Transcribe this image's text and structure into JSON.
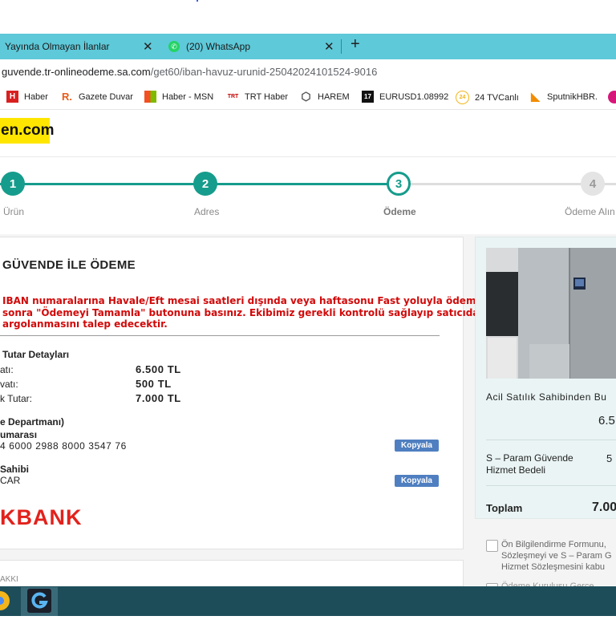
{
  "browser": {
    "tabs": [
      {
        "title": "Yayında Olmayan İlanlar",
        "close": "✕"
      },
      {
        "title": "(20) WhatsApp",
        "close": "✕"
      }
    ],
    "new_tab": "+",
    "url_host": "guvende.tr-onlineodeme.sa.com",
    "url_path": "/get60/iban-havuz-urunid-25042024101524-9016",
    "bookmarks": [
      {
        "label": "Haber",
        "icon": "H",
        "color": "#d92020"
      },
      {
        "label": "Gazete Duvar",
        "icon": "R.",
        "color": "#e85c1a"
      },
      {
        "label": "Haber - MSN",
        "icon": "▦",
        "color": "#f25022"
      },
      {
        "label": "TRT Haber",
        "icon": "TRT",
        "color": "#c00000"
      },
      {
        "label": "HAREM",
        "icon": "⬡",
        "color": "#555555"
      },
      {
        "label": "EURUSD1.08992",
        "icon": "17",
        "color": "#111111"
      },
      {
        "label": "24 TVCanlı",
        "icon": "24",
        "color": "#f2b51a"
      },
      {
        "label": "SputnikHBR.",
        "icon": "◣",
        "color": "#f28c00"
      }
    ]
  },
  "site": {
    "logo": "en.com",
    "steps": [
      {
        "num": "1",
        "label": "Ürün"
      },
      {
        "num": "2",
        "label": "Adres"
      },
      {
        "num": "3",
        "label": "Ödeme"
      },
      {
        "num": "4",
        "label": "Ödeme Alın"
      }
    ]
  },
  "payment": {
    "title": "GÜVENDE İLE ÖDEME",
    "warning_lines": [
      "IBAN numaralarına Havale/Eft mesai saatleri dışında veya haftasonu Fast yoluyla ödeme",
      "sonra \"Ödemeyi Tamamla\" butonuna basınız. Ekibimiz gerekli kontrolü sağlayıp satıcıdan",
      "argolanmasını talep edecektir."
    ],
    "details_title": "Tutar Detayları",
    "rows": [
      {
        "label": "atı:",
        "value": "6.500 TL"
      },
      {
        "label": "vatı:",
        "value": "500 TL"
      },
      {
        "label": "k Tutar:",
        "value": "7.000 TL"
      }
    ],
    "dept_title": "e Departmanı)",
    "iban_label": "umarası",
    "iban_value": "4 6000 2988 8000 3547 76",
    "copy_label": "Kopyala",
    "owner_label": "Sahibi",
    "owner_value": "CAR",
    "bank_logo": "KBANK",
    "footer_label": "AKKI"
  },
  "summary": {
    "product_title": "Acil Satılık Sahibinden Bu",
    "price_partial": "6.5",
    "fee_label_1": "S – Param Güvende",
    "fee_label_2": "Hizmet Bedeli",
    "fee_partial": "5",
    "total_label": "Toplam",
    "total_partial": "7.00",
    "consent_1": "Ön Bilgilendirme Formunu,",
    "consent_2": "Sözleşmeyi ve S – Param G",
    "consent_3": "Hizmet Sözleşmesini kabu",
    "consent_4": "Ödeme Kuruluşu Gerçe..."
  },
  "colors": {
    "tab_bar": "#5ec9d9",
    "step_active": "#169c8c",
    "warning_red": "#d10a0a",
    "copy_button": "#4f7fc0",
    "logo_yellow": "#ffe600",
    "taskbar": "#1e4d5a"
  }
}
